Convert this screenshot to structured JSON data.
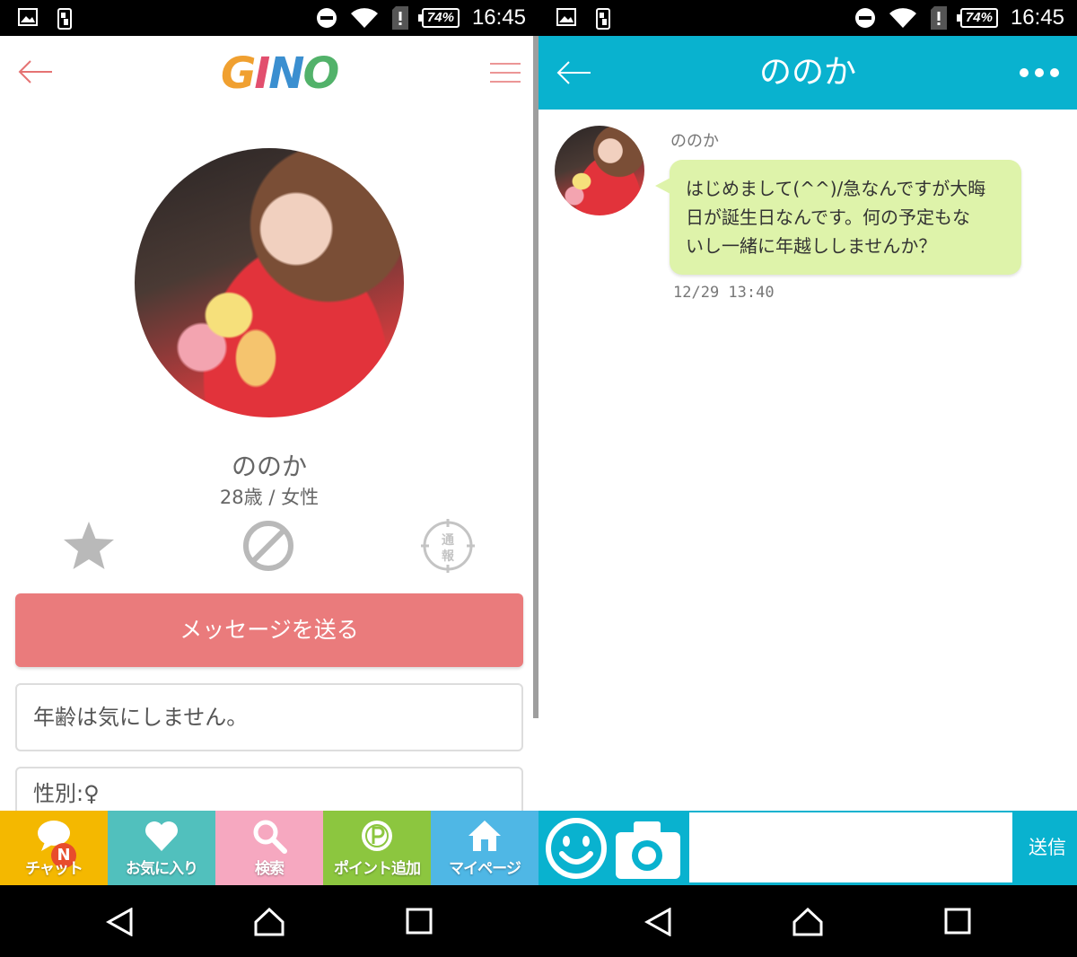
{
  "status_bar": {
    "time": "16:45",
    "battery": "74%"
  },
  "profile_screen": {
    "logo_letters": [
      "G",
      "I",
      "N",
      "O"
    ],
    "name": "ののか",
    "info": "28歳 / 女性",
    "report_label_top": "通",
    "report_label_bottom": "報",
    "send_message_label": "メッセージを送る",
    "about_text": "年齢は気にしません。",
    "gender_text": "性別:♀",
    "tabs": [
      {
        "label": "チャット",
        "color": "#f4b800",
        "icon": "chat-icon",
        "badge": "N"
      },
      {
        "label": "お気に入り",
        "color": "#51c0bd",
        "icon": "heart-icon"
      },
      {
        "label": "検索",
        "color": "#f6a8c0",
        "icon": "search-icon"
      },
      {
        "label": "ポイント追加",
        "color": "#8cc63f",
        "icon": "point-icon"
      },
      {
        "label": "マイページ",
        "color": "#4fb7e5",
        "icon": "home-icon"
      }
    ]
  },
  "chat_screen": {
    "title": "ののか",
    "sender": "ののか",
    "message_lines": [
      "はじめまして(^^)/急なんですが大晦",
      "日が誕生日なんです。何の予定もな",
      "いし一緒に年越ししませんか？"
    ],
    "time": "12/29 13:40",
    "input_value": "",
    "send_label": "送信"
  },
  "colors": {
    "accent_pink": "#ea7b7c",
    "header_cyan": "#09b2cf",
    "bubble_green": "#def3aa"
  }
}
